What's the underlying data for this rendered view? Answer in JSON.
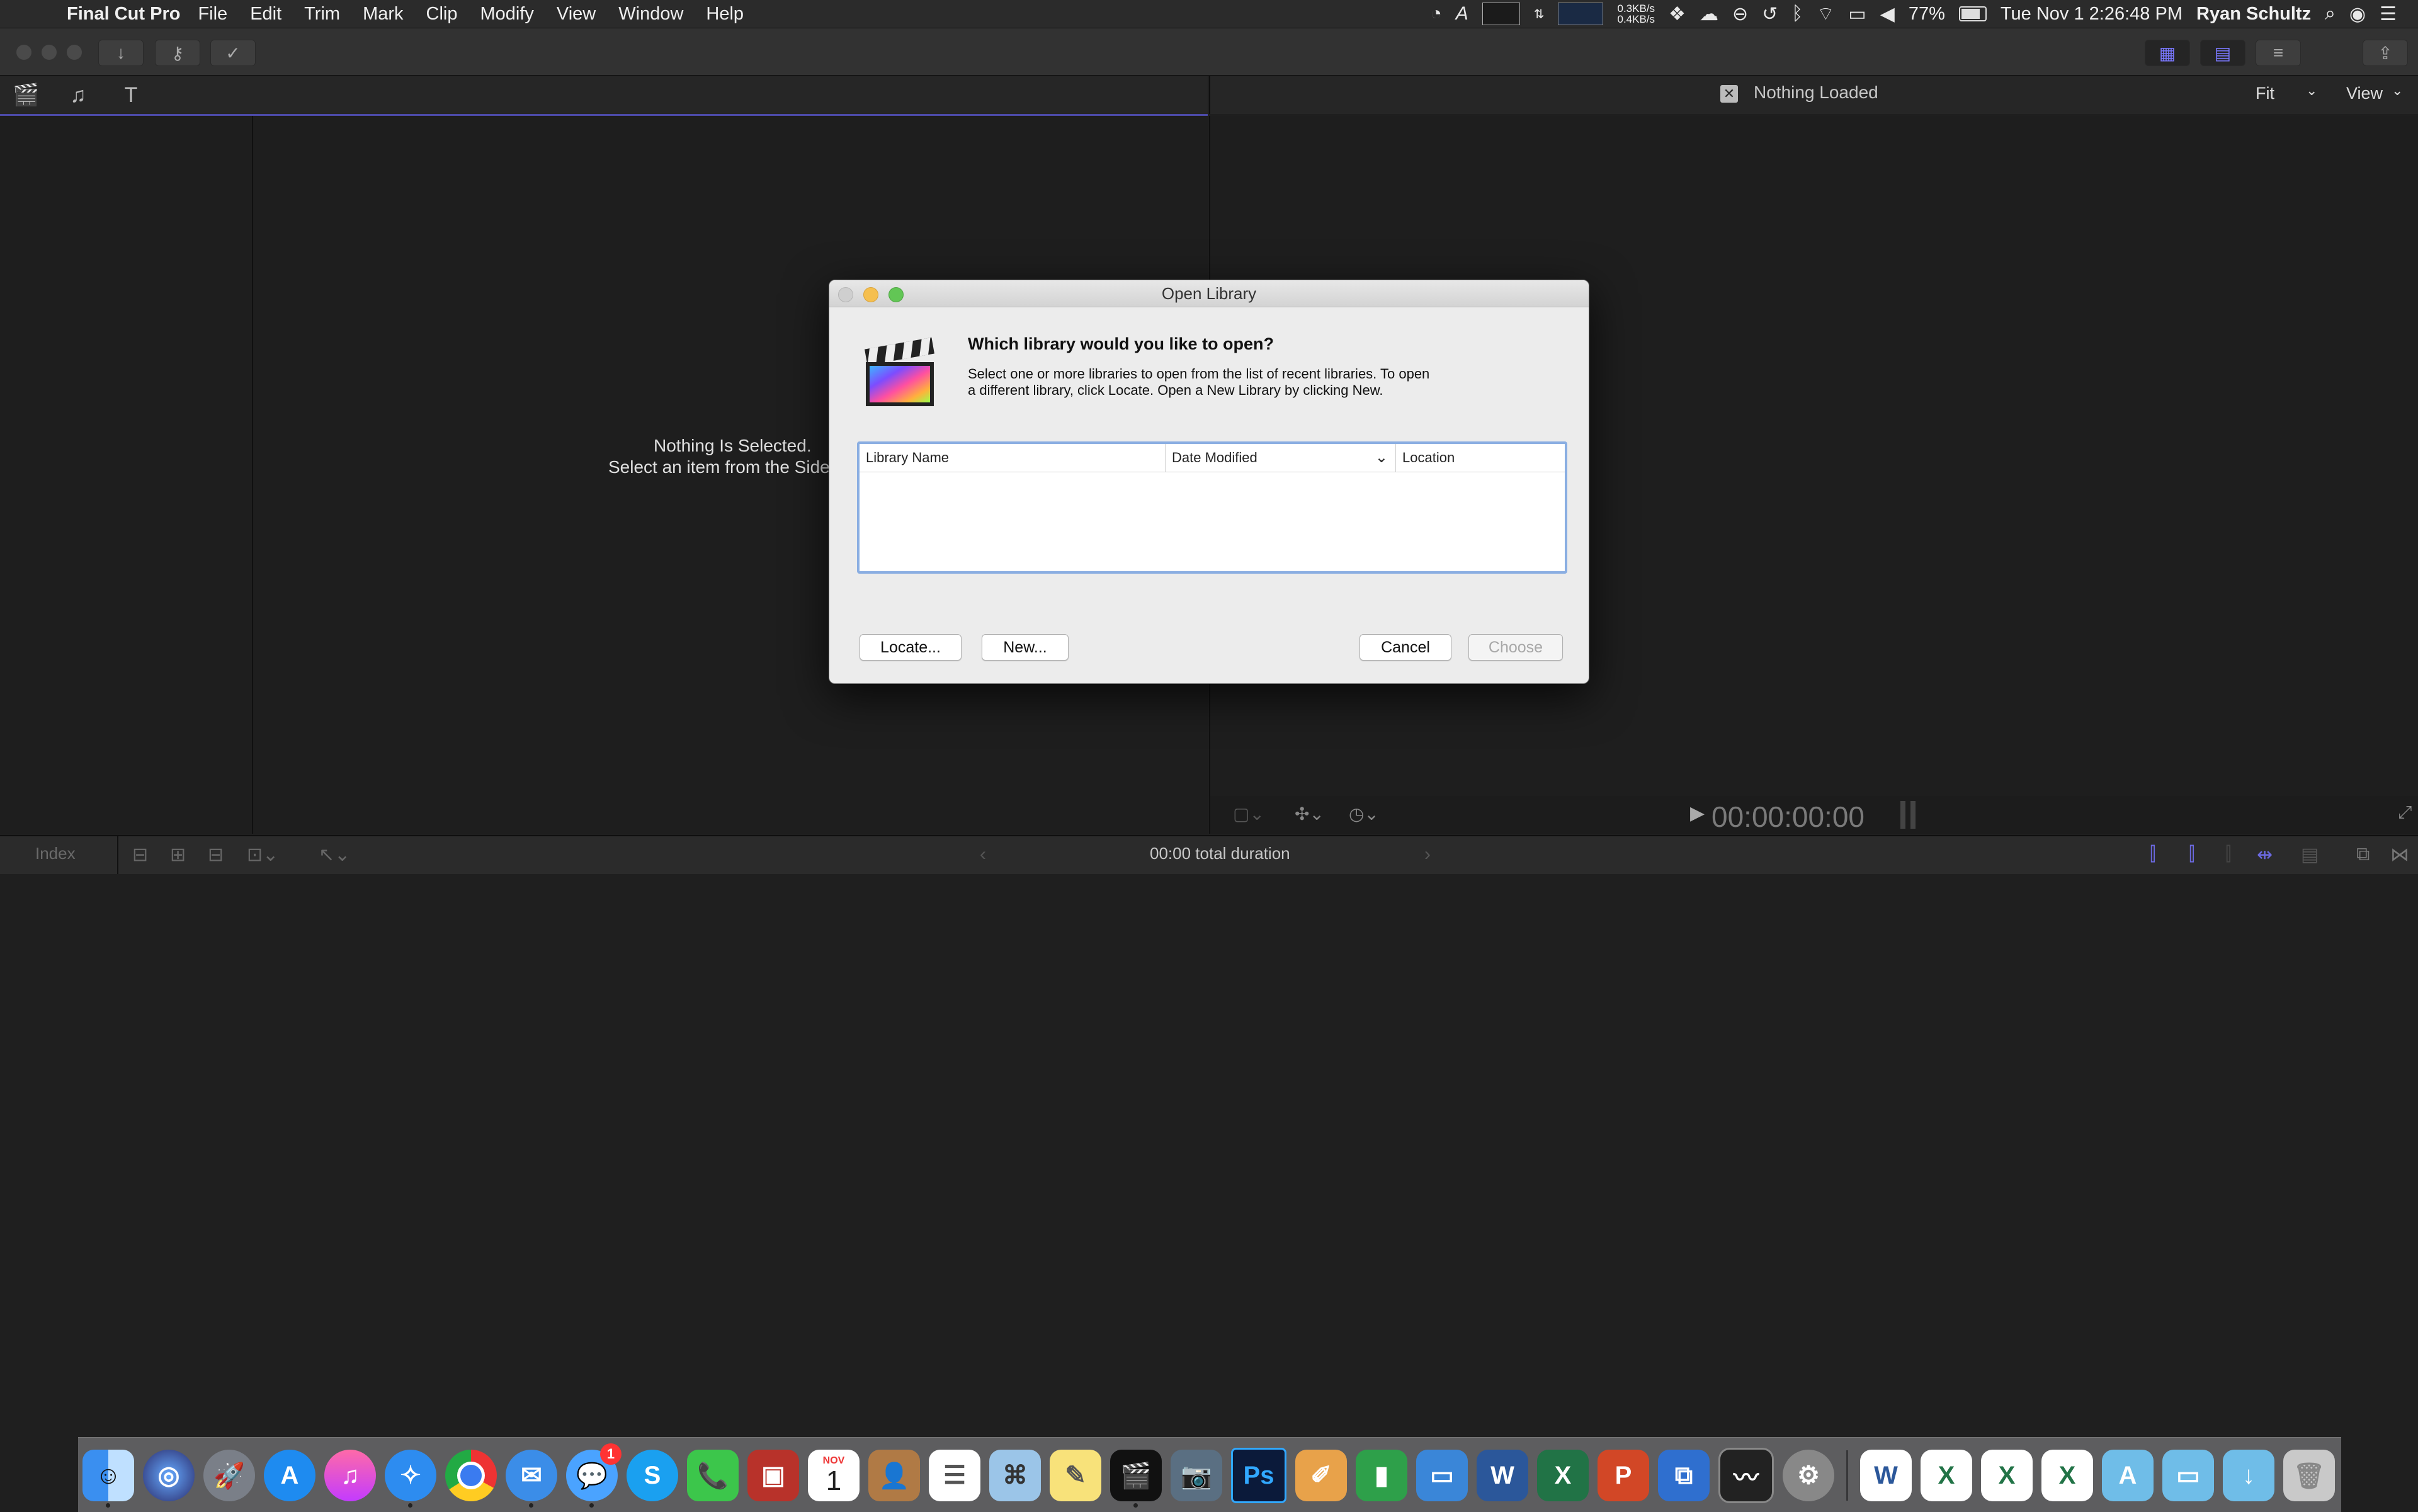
{
  "menubar": {
    "app_name": "Final Cut Pro",
    "menus": [
      "File",
      "Edit",
      "Trim",
      "Mark",
      "Clip",
      "Modify",
      "View",
      "Window",
      "Help"
    ],
    "status": {
      "net_up": "0.3KB/s",
      "net_down": "0.4KB/s",
      "battery": "77%",
      "datetime": "Tue Nov 1  2:26:48 PM",
      "user": "Ryan Schultz"
    }
  },
  "browser": {
    "empty_line1": "Nothing Is Selected.",
    "empty_line2": "Select an item from the Sidebar"
  },
  "viewer": {
    "status": "Nothing Loaded",
    "zoom": "Fit",
    "view_menu": "View",
    "timecode": "00:00:00:00"
  },
  "timeline": {
    "index_label": "Index",
    "duration": "00:00 total duration"
  },
  "dialog": {
    "title": "Open Library",
    "heading": "Which library would you like to open?",
    "desc_line1": "Select one or more libraries to open from the list of recent libraries.  To open",
    "desc_line2": "a different library, click Locate. Open a New Library by clicking New.",
    "columns": [
      "Library Name",
      "Date Modified",
      "Location"
    ],
    "buttons": {
      "locate": "Locate...",
      "new": "New...",
      "cancel": "Cancel",
      "choose": "Choose"
    }
  },
  "dock": {
    "messages_badge": "1",
    "calendar_month": "NOV",
    "calendar_day": "1"
  },
  "colors": {
    "accent_purple": "#7a78ff",
    "dialog_bg": "#ececec",
    "focus_ring": "#8aaee2"
  }
}
